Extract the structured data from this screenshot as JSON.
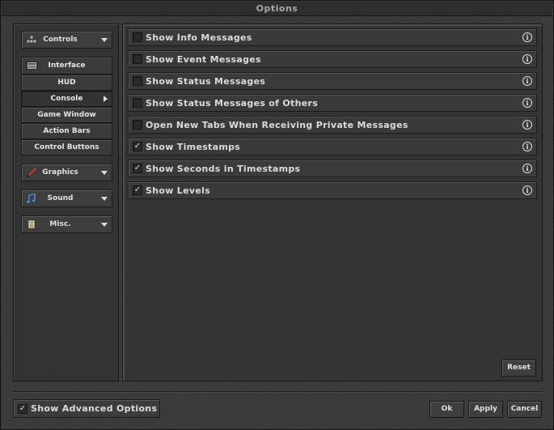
{
  "window": {
    "title": "Options"
  },
  "sidebar": {
    "controls_label": "Controls",
    "interface_label": "Interface",
    "interface_items": [
      "HUD",
      "Console",
      "Game Window",
      "Action Bars",
      "Control Buttons"
    ],
    "active_item": "Console",
    "graphics_label": "Graphics",
    "sound_label": "Sound",
    "misc_label": "Misc."
  },
  "options": [
    {
      "label": "Show Info Messages",
      "checked": false
    },
    {
      "label": "Show Event Messages",
      "checked": false
    },
    {
      "label": "Show Status Messages",
      "checked": false
    },
    {
      "label": "Show Status Messages of Others",
      "checked": false
    },
    {
      "label": "Open New Tabs When Receiving Private Messages",
      "checked": false
    },
    {
      "label": "Show Timestamps",
      "checked": true
    },
    {
      "label": "Show Seconds in Timestamps",
      "checked": true
    },
    {
      "label": "Show Levels",
      "checked": true
    }
  ],
  "info_glyph": "i",
  "check_glyph": "✓",
  "reset_label": "Reset",
  "footer": {
    "advanced_label": "Show Advanced Options",
    "advanced_checked": true,
    "ok_label": "Ok",
    "apply_label": "Apply",
    "cancel_label": "Cancel"
  }
}
